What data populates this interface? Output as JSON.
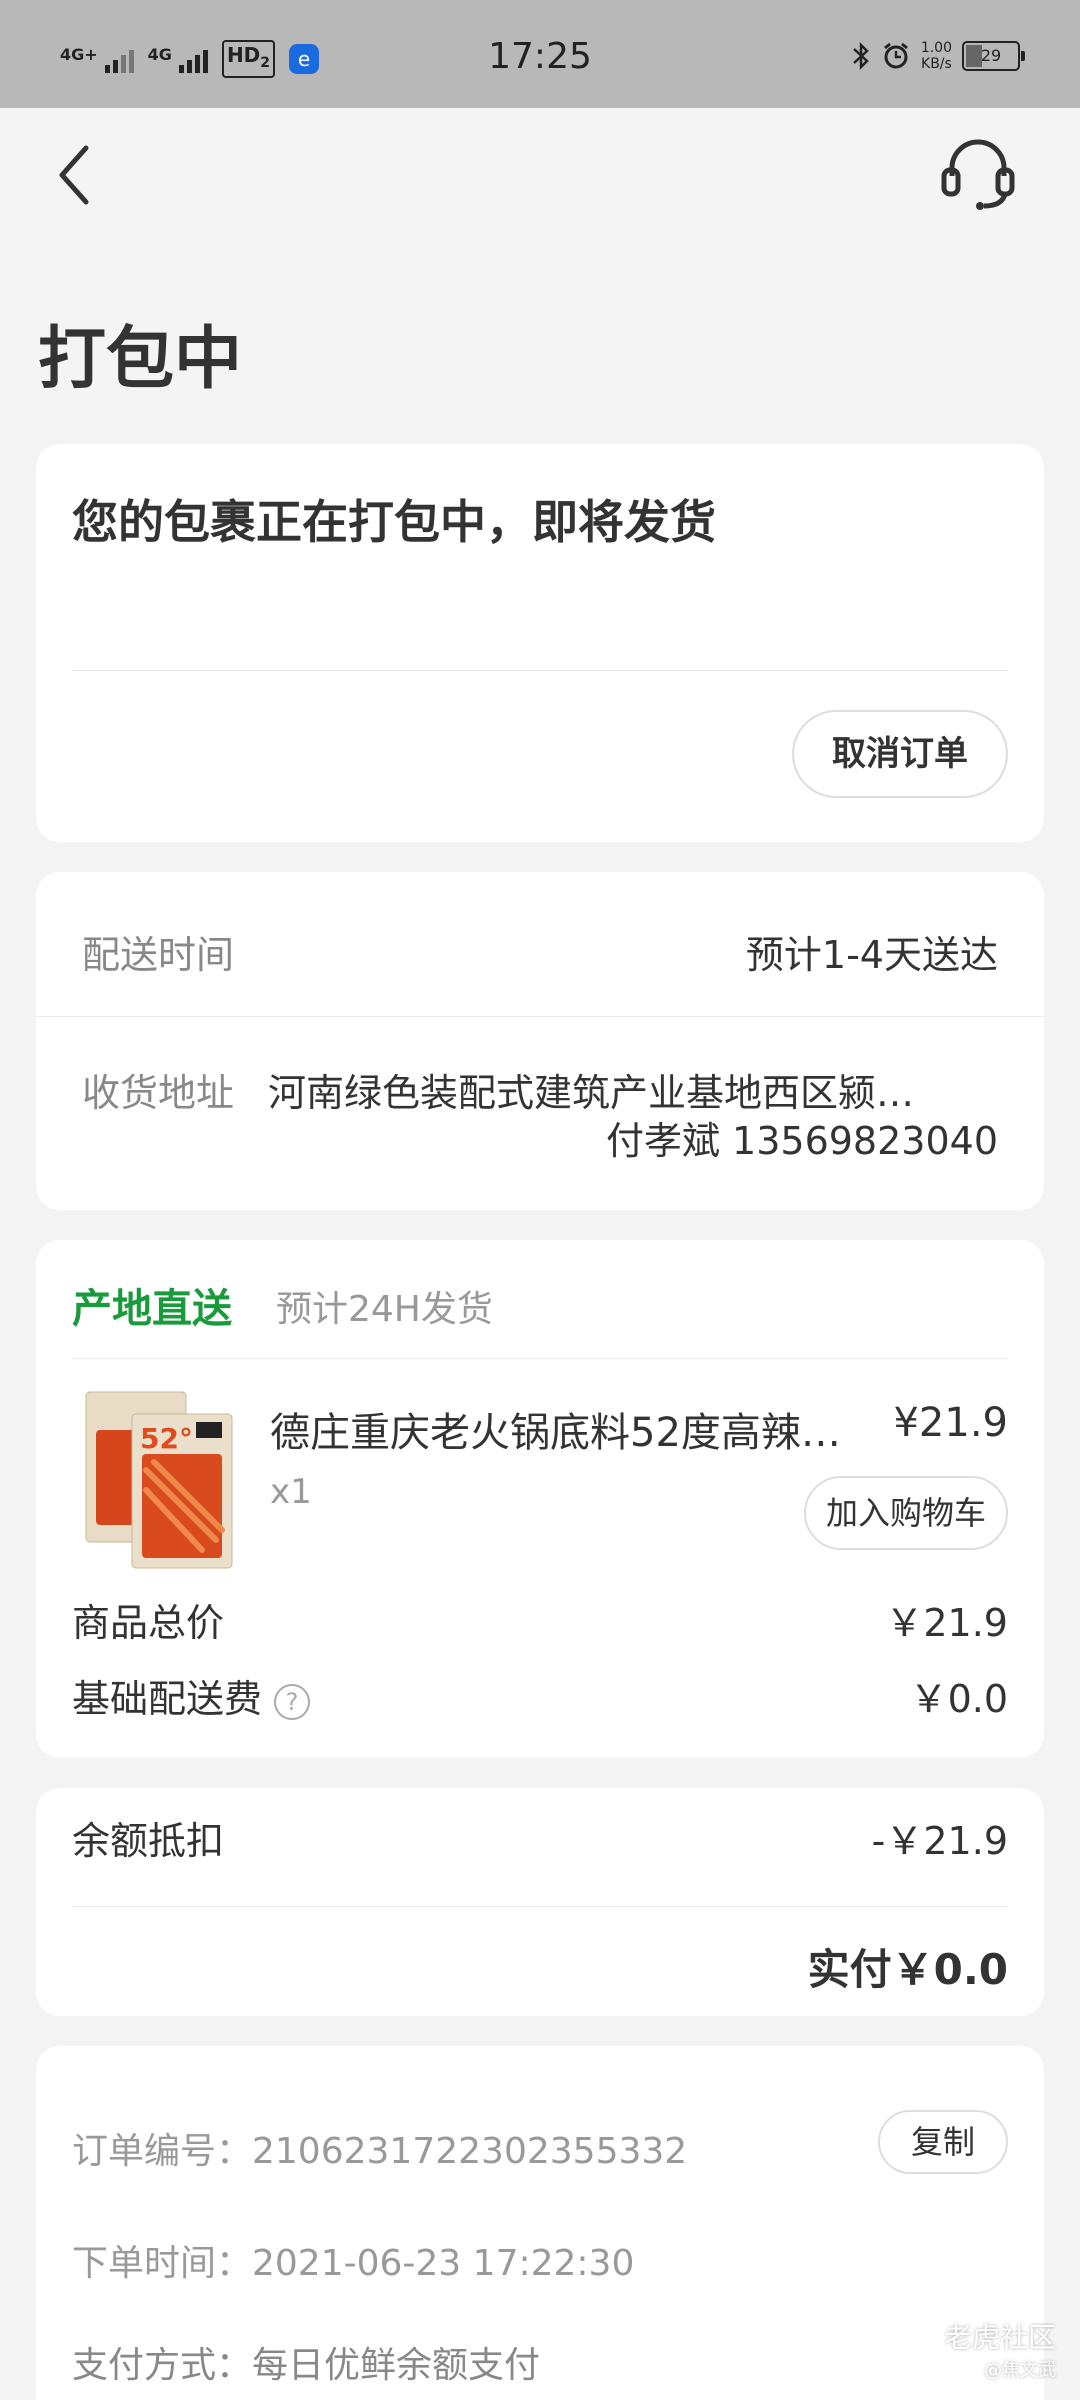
{
  "status_bar": {
    "network1": "4G+",
    "network2": "4G",
    "hd": "HD",
    "hd_sub": "2",
    "time": "17:25",
    "speed_value": "1.00",
    "speed_unit": "KB/s",
    "battery_level": "29"
  },
  "page": {
    "title": "打包中"
  },
  "status_card": {
    "message": "您的包裹正在打包中，即将发货",
    "cancel_label": "取消订单"
  },
  "delivery_card": {
    "time_label": "配送时间",
    "time_value": "预计1-4天送达",
    "address_label": "收货地址",
    "address_value": "河南绿色装配式建筑产业基地西区颍…",
    "recipient": "付孝斌 13569823040"
  },
  "goods_card": {
    "origin_label": "产地直送",
    "ship_note": "预计24H发货",
    "product": {
      "name": "德庄重庆老火锅底料52度高辣…",
      "price": "¥21.9",
      "quantity": "x1",
      "image_text": "52°",
      "add_to_cart_label": "加入购物车"
    },
    "subtotal_label": "商品总价",
    "subtotal_value": "￥21.9",
    "shipping_label": "基础配送费",
    "shipping_value": "￥0.0"
  },
  "payment_card": {
    "balance_label": "余额抵扣",
    "balance_value": "-￥21.9",
    "paid_label": "实付￥0.0"
  },
  "info_card": {
    "order_no": "订单编号：2106231722302355332",
    "copy_label": "复制",
    "order_time": "下单时间：2021-06-23 17:22:30",
    "pay_method": "支付方式：每日优鲜余额支付"
  },
  "watermark": {
    "text": "老虎社区",
    "sub": "@焦文武"
  },
  "colors": {
    "accent_green": "#1a9b3b",
    "background": "#f4f4f4",
    "card": "#ffffff",
    "status_bar": "#b8b8b8"
  }
}
